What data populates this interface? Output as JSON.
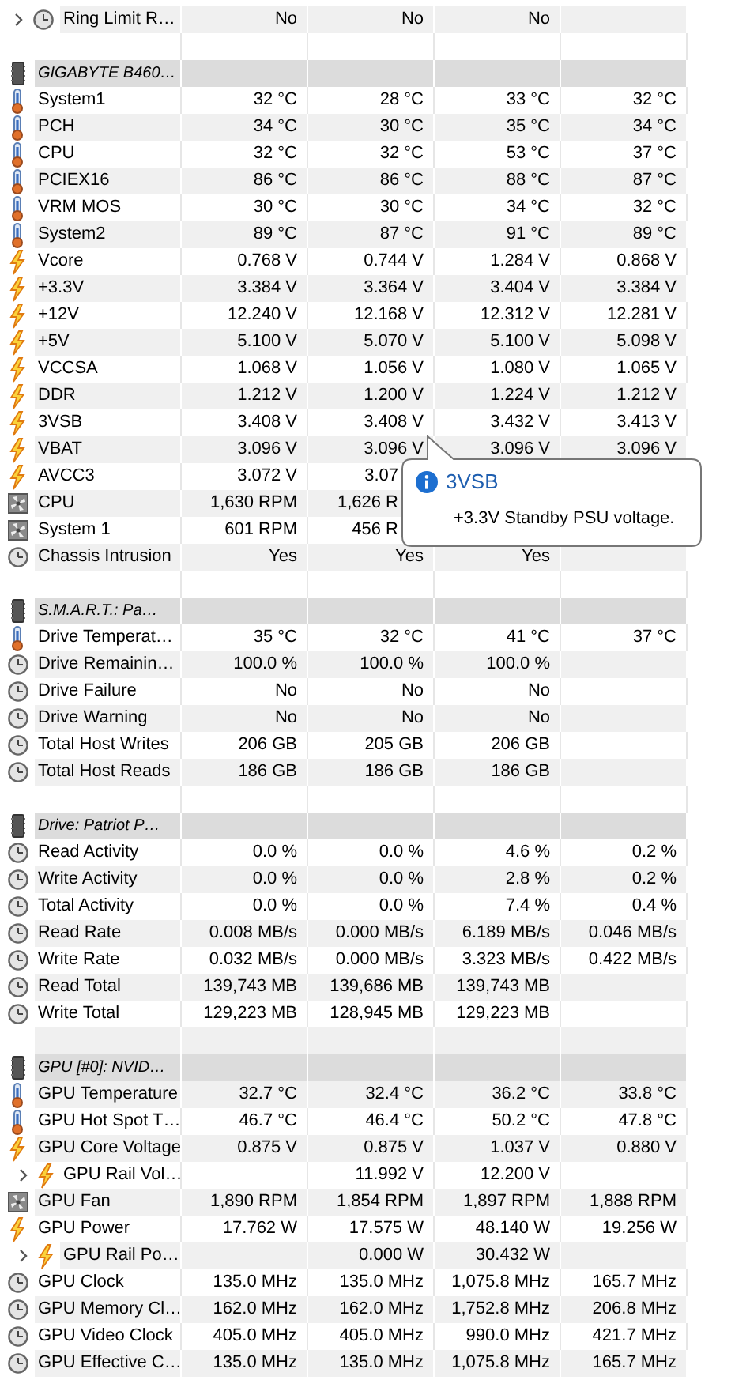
{
  "sections": [
    {
      "rows": [
        {
          "kind": "clock",
          "label": "Ring Limit R…",
          "expandable": true,
          "value_1": "No",
          "value_2": "No",
          "value_3": "No"
        }
      ]
    },
    {
      "title": "GIGABYTE B460…",
      "rows": [
        {
          "kind": "temperature",
          "label": "System1",
          "value_1": "32 °C",
          "value_2": "28 °C",
          "value_3": "33 °C",
          "value_4": "32 °C"
        },
        {
          "kind": "temperature",
          "label": "PCH",
          "value_1": "34 °C",
          "value_2": "30 °C",
          "value_3": "35 °C",
          "value_4": "34 °C"
        },
        {
          "kind": "temperature",
          "label": "CPU",
          "value_1": "32 °C",
          "value_2": "32 °C",
          "value_3": "53 °C",
          "value_4": "37 °C"
        },
        {
          "kind": "temperature",
          "label": "PCIEX16",
          "value_1": "86 °C",
          "value_2": "86 °C",
          "value_3": "88 °C",
          "value_4": "87 °C"
        },
        {
          "kind": "temperature",
          "label": "VRM MOS",
          "value_1": "30 °C",
          "value_2": "30 °C",
          "value_3": "34 °C",
          "value_4": "32 °C"
        },
        {
          "kind": "temperature",
          "label": "System2",
          "value_1": "89 °C",
          "value_2": "87 °C",
          "value_3": "91 °C",
          "value_4": "89 °C"
        },
        {
          "kind": "power",
          "label": "Vcore",
          "value_1": "0.768 V",
          "value_2": "0.744 V",
          "value_3": "1.284 V",
          "value_4": "0.868 V"
        },
        {
          "kind": "power",
          "label": "+3.3V",
          "value_1": "3.384 V",
          "value_2": "3.364 V",
          "value_3": "3.404 V",
          "value_4": "3.384 V"
        },
        {
          "kind": "power",
          "label": "+12V",
          "value_1": "12.240 V",
          "value_2": "12.168 V",
          "value_3": "12.312 V",
          "value_4": "12.281 V"
        },
        {
          "kind": "power",
          "label": "+5V",
          "value_1": "5.100 V",
          "value_2": "5.070 V",
          "value_3": "5.100 V",
          "value_4": "5.098 V"
        },
        {
          "kind": "power",
          "label": "VCCSA",
          "value_1": "1.068 V",
          "value_2": "1.056 V",
          "value_3": "1.080 V",
          "value_4": "1.065 V"
        },
        {
          "kind": "power",
          "label": "DDR",
          "value_1": "1.212 V",
          "value_2": "1.200 V",
          "value_3": "1.224 V",
          "value_4": "1.212 V"
        },
        {
          "kind": "power",
          "label": "3VSB",
          "value_1": "3.408 V",
          "value_2": "3.408 V",
          "value_3": "3.432 V",
          "value_4": "3.413 V"
        },
        {
          "kind": "power",
          "label": "VBAT",
          "value_1": "3.096 V",
          "value_2": "3.096 V",
          "value_3": "3.096 V",
          "value_4": "3.096 V"
        },
        {
          "kind": "power",
          "label": "AVCC3",
          "covered": true,
          "value_1": "3.072 V",
          "value_2": "3.07"
        },
        {
          "kind": "fan",
          "label": "CPU",
          "covered": true,
          "value_1": "1,630 RPM",
          "value_2": "1,626 R"
        },
        {
          "kind": "fan",
          "label": "System 1",
          "covered": true,
          "value_1": "601 RPM",
          "value_2": "456 R"
        },
        {
          "kind": "clock",
          "label": "Chassis Intrusion",
          "value_1": "Yes",
          "value_2": "Yes",
          "value_3": "Yes"
        }
      ]
    },
    {
      "title": "S.M.A.R.T.: Pa…",
      "rows": [
        {
          "kind": "temperature",
          "label": "Drive Temperat…",
          "value_1": "35 °C",
          "value_2": "32 °C",
          "value_3": "41 °C",
          "value_4": "37 °C"
        },
        {
          "kind": "clock",
          "label": "Drive Remainin…",
          "value_1": "100.0 %",
          "value_2": "100.0 %",
          "value_3": "100.0 %"
        },
        {
          "kind": "clock",
          "label": "Drive Failure",
          "value_1": "No",
          "value_2": "No",
          "value_3": "No"
        },
        {
          "kind": "clock",
          "label": "Drive Warning",
          "value_1": "No",
          "value_2": "No",
          "value_3": "No"
        },
        {
          "kind": "clock",
          "label": "Total Host Writes",
          "value_1": "206 GB",
          "value_2": "205 GB",
          "value_3": "206 GB"
        },
        {
          "kind": "clock",
          "label": "Total Host Reads",
          "value_1": "186 GB",
          "value_2": "186 GB",
          "value_3": "186 GB"
        }
      ]
    },
    {
      "title": "Drive: Patriot P…",
      "rows": [
        {
          "kind": "clock",
          "label": "Read Activity",
          "value_1": "0.0 %",
          "value_2": "0.0 %",
          "value_3": "4.6 %",
          "value_4": "0.2 %"
        },
        {
          "kind": "clock",
          "label": "Write Activity",
          "value_1": "0.0 %",
          "value_2": "0.0 %",
          "value_3": "2.8 %",
          "value_4": "0.2 %"
        },
        {
          "kind": "clock",
          "label": "Total Activity",
          "value_1": "0.0 %",
          "value_2": "0.0 %",
          "value_3": "7.4 %",
          "value_4": "0.4 %"
        },
        {
          "kind": "clock",
          "label": "Read Rate",
          "value_1": "0.008 MB/s",
          "value_2": "0.000 MB/s",
          "value_3": "6.189 MB/s",
          "value_4": "0.046 MB/s"
        },
        {
          "kind": "clock",
          "label": "Write Rate",
          "value_1": "0.032 MB/s",
          "value_2": "0.000 MB/s",
          "value_3": "3.323 MB/s",
          "value_4": "0.422 MB/s"
        },
        {
          "kind": "clock",
          "label": "Read Total",
          "value_1": "139,743 MB",
          "value_2": "139,686 MB",
          "value_3": "139,743 MB"
        },
        {
          "kind": "clock",
          "label": "Write Total",
          "value_1": "129,223 MB",
          "value_2": "128,945 MB",
          "value_3": "129,223 MB"
        }
      ]
    },
    {
      "title": "GPU [#0]: NVID…",
      "rows": [
        {
          "kind": "temperature",
          "label": "GPU Temperature",
          "value_1": "32.7 °C",
          "value_2": "32.4 °C",
          "value_3": "36.2 °C",
          "value_4": "33.8 °C"
        },
        {
          "kind": "temperature",
          "label": "GPU Hot Spot T…",
          "value_1": "46.7 °C",
          "value_2": "46.4 °C",
          "value_3": "50.2 °C",
          "value_4": "47.8 °C"
        },
        {
          "kind": "power",
          "label": "GPU Core Voltage",
          "value_1": "0.875 V",
          "value_2": "0.875 V",
          "value_3": "1.037 V",
          "value_4": "0.880 V"
        },
        {
          "kind": "power",
          "label": "GPU Rail Vol…",
          "expandable": true,
          "value_2": "11.992 V",
          "value_3": "12.200 V"
        },
        {
          "kind": "fan",
          "label": "GPU Fan",
          "value_1": "1,890 RPM",
          "value_2": "1,854 RPM",
          "value_3": "1,897 RPM",
          "value_4": "1,888 RPM"
        },
        {
          "kind": "power",
          "label": "GPU Power",
          "value_1": "17.762 W",
          "value_2": "17.575 W",
          "value_3": "48.140 W",
          "value_4": "19.256 W"
        },
        {
          "kind": "power",
          "label": "GPU Rail Po…",
          "expandable": true,
          "value_2": "0.000 W",
          "value_3": "30.432 W"
        },
        {
          "kind": "clock",
          "label": "GPU Clock",
          "value_1": "135.0 MHz",
          "value_2": "135.0 MHz",
          "value_3": "1,075.8 MHz",
          "value_4": "165.7 MHz"
        },
        {
          "kind": "clock",
          "label": "GPU Memory Cl…",
          "value_1": "162.0 MHz",
          "value_2": "162.0 MHz",
          "value_3": "1,752.8 MHz",
          "value_4": "206.8 MHz"
        },
        {
          "kind": "clock",
          "label": "GPU Video Clock",
          "value_1": "405.0 MHz",
          "value_2": "405.0 MHz",
          "value_3": "990.0 MHz",
          "value_4": "421.7 MHz"
        },
        {
          "kind": "clock",
          "label": "GPU Effective C…",
          "value_1": "135.0 MHz",
          "value_2": "135.0 MHz",
          "value_3": "1,075.8 MHz",
          "value_4": "165.7 MHz"
        }
      ]
    }
  ],
  "tooltip": {
    "title": "3VSB",
    "text": "+3.3V Standby PSU voltage."
  }
}
